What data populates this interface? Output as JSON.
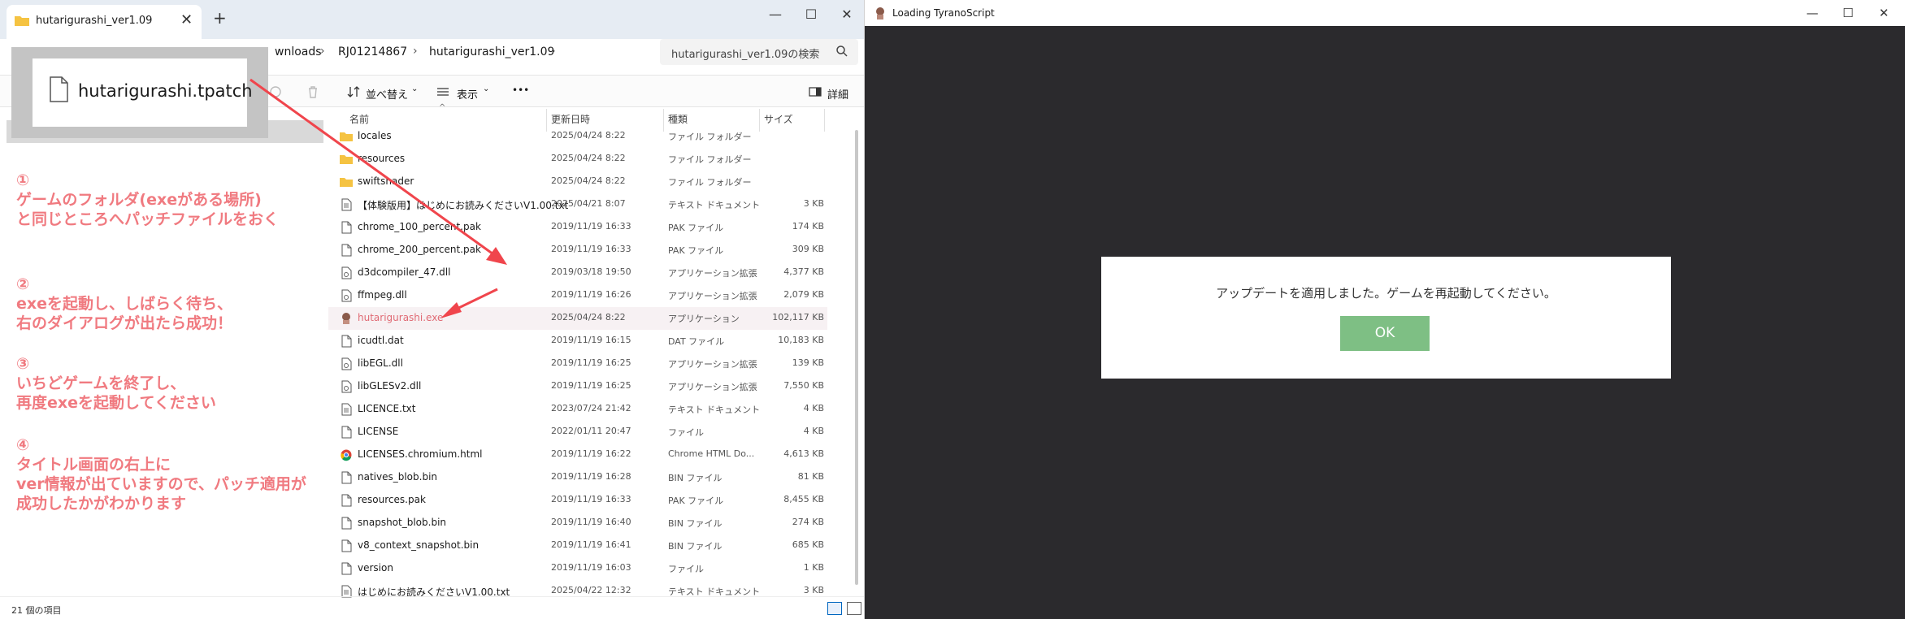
{
  "explorer": {
    "tab_title": "hutarigurashi_ver1.09",
    "tab_close": "✕",
    "tab_new": "+",
    "window_controls": [
      "—",
      "☐",
      "✕"
    ],
    "breadcrumbs": [
      "wnloads",
      "RJ01214867",
      "hutarigurashi_ver1.09"
    ],
    "breadcrumb_separator": "›",
    "search_placeholder": "hutarigurashi_ver1.09の検索",
    "toolbar": {
      "sort_label": "並べ替え",
      "view_label": "表示",
      "more_label": "•••",
      "details_label": "詳細"
    },
    "columns": {
      "name": "名前",
      "date": "更新日時",
      "type": "種類",
      "size": "サイズ"
    },
    "sort_caret": "^",
    "files": [
      {
        "name": "locales",
        "date": "2025/04/24 8:22",
        "type": "ファイル フォルダー",
        "size": "",
        "icon": "folder-icon"
      },
      {
        "name": "resources",
        "date": "2025/04/24 8:22",
        "type": "ファイル フォルダー",
        "size": "",
        "icon": "folder-icon"
      },
      {
        "name": "swiftshader",
        "date": "2025/04/24 8:22",
        "type": "ファイル フォルダー",
        "size": "",
        "icon": "folder-icon"
      },
      {
        "name": "【体験版用】はじめにお読みくださいV1.00.txt",
        "date": "2025/04/21 8:07",
        "type": "テキスト ドキュメント",
        "size": "3 KB",
        "icon": "text-file-icon"
      },
      {
        "name": "chrome_100_percent.pak",
        "date": "2019/11/19 16:33",
        "type": "PAK ファイル",
        "size": "174 KB",
        "icon": "file-icon"
      },
      {
        "name": "chrome_200_percent.pak",
        "date": "2019/11/19 16:33",
        "type": "PAK ファイル",
        "size": "309 KB",
        "icon": "file-icon"
      },
      {
        "name": "d3dcompiler_47.dll",
        "date": "2019/03/18 19:50",
        "type": "アプリケーション拡張",
        "size": "4,377 KB",
        "icon": "dll-icon"
      },
      {
        "name": "ffmpeg.dll",
        "date": "2019/11/19 16:26",
        "type": "アプリケーション拡張",
        "size": "2,079 KB",
        "icon": "dll-icon"
      },
      {
        "name": "hutarigurashi.exe",
        "date": "2025/04/24 8:22",
        "type": "アプリケーション",
        "size": "102,117 KB",
        "icon": "exe-icon",
        "selected": true
      },
      {
        "name": "icudtl.dat",
        "date": "2019/11/19 16:15",
        "type": "DAT ファイル",
        "size": "10,183 KB",
        "icon": "file-icon"
      },
      {
        "name": "libEGL.dll",
        "date": "2019/11/19 16:25",
        "type": "アプリケーション拡張",
        "size": "139 KB",
        "icon": "dll-icon"
      },
      {
        "name": "libGLESv2.dll",
        "date": "2019/11/19 16:25",
        "type": "アプリケーション拡張",
        "size": "7,550 KB",
        "icon": "dll-icon"
      },
      {
        "name": "LICENCE.txt",
        "date": "2023/07/24 21:42",
        "type": "テキスト ドキュメント",
        "size": "4 KB",
        "icon": "text-file-icon"
      },
      {
        "name": "LICENSE",
        "date": "2022/01/11 20:47",
        "type": "ファイル",
        "size": "4 KB",
        "icon": "file-icon"
      },
      {
        "name": "LICENSES.chromium.html",
        "date": "2019/11/19 16:22",
        "type": "Chrome HTML Do...",
        "size": "4,613 KB",
        "icon": "chrome-html-icon"
      },
      {
        "name": "natives_blob.bin",
        "date": "2019/11/19 16:28",
        "type": "BIN ファイル",
        "size": "81 KB",
        "icon": "file-icon"
      },
      {
        "name": "resources.pak",
        "date": "2019/11/19 16:33",
        "type": "PAK ファイル",
        "size": "8,455 KB",
        "icon": "file-icon"
      },
      {
        "name": "snapshot_blob.bin",
        "date": "2019/11/19 16:40",
        "type": "BIN ファイル",
        "size": "274 KB",
        "icon": "file-icon"
      },
      {
        "name": "v8_context_snapshot.bin",
        "date": "2019/11/19 16:41",
        "type": "BIN ファイル",
        "size": "685 KB",
        "icon": "file-icon"
      },
      {
        "name": "version",
        "date": "2019/11/19 16:03",
        "type": "ファイル",
        "size": "1 KB",
        "icon": "file-icon"
      },
      {
        "name": "はじめにお読みくださいV1.00.txt",
        "date": "2025/04/22 12:32",
        "type": "テキスト ドキュメント",
        "size": "3 KB",
        "icon": "text-file-icon"
      }
    ],
    "status_text": "21 個の項目"
  },
  "callout": {
    "patch_file_name": "hutarigurashi.tpatch"
  },
  "instructions": [
    {
      "lines": [
        "①",
        "ゲームのフォルダ(exeがある場所)",
        "と同じところへパッチファイルをおく"
      ]
    },
    {
      "lines": [
        "②",
        "exeを起動し、しばらく待ち、",
        "右のダイアログが出たら成功！"
      ]
    },
    {
      "lines": [
        "③",
        "いちどゲームを終了し、",
        "再度exeを起動してください"
      ]
    },
    {
      "lines": [
        "④",
        "タイトル画面の右上に",
        "ver情報が出ていますので、パッチ適用が",
        "成功したかがわかります"
      ]
    }
  ],
  "tyrano": {
    "title": "Loading TyranoScript",
    "window_controls": [
      "—",
      "☐",
      "✕"
    ],
    "dialog_message": "アップデートを適用しました。ゲームを再起動してください。",
    "ok_label": "OK"
  },
  "colors": {
    "annotation": "#f07a80",
    "arrow": "#f0454c",
    "ok_button": "#7ebf84",
    "dialog_backdrop": "#2b2a2d"
  }
}
